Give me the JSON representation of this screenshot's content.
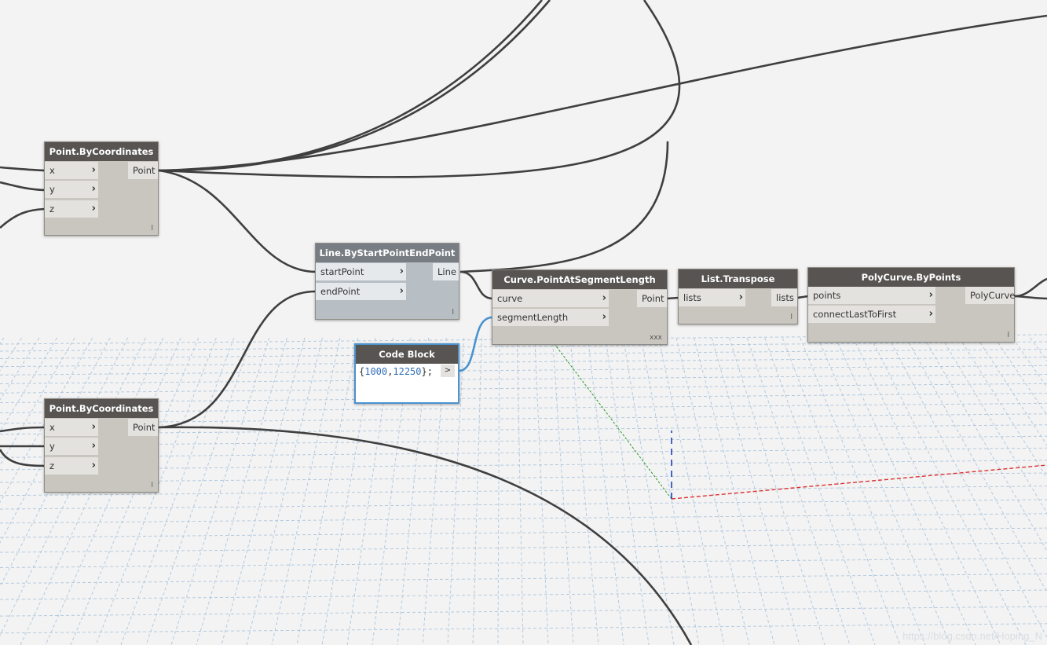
{
  "nodes": {
    "point1": {
      "title": "Point.ByCoordinates",
      "inputs": [
        "x",
        "y",
        "z"
      ],
      "output": "Point",
      "lacing": "l"
    },
    "point2": {
      "title": "Point.ByCoordinates",
      "inputs": [
        "x",
        "y",
        "z"
      ],
      "output": "Point",
      "lacing": "l"
    },
    "line": {
      "title": "Line.ByStartPointEndPoint",
      "inputs": [
        "startPoint",
        "endPoint"
      ],
      "output": "Line",
      "lacing": "l"
    },
    "curve_pt": {
      "title": "Curve.PointAtSegmentLength",
      "inputs": [
        "curve",
        "segmentLength"
      ],
      "output": "Point",
      "lacing": "xxx"
    },
    "transpose": {
      "title": "List.Transpose",
      "inputs": [
        "lists"
      ],
      "output": "lists",
      "lacing": "l"
    },
    "polycurve": {
      "title": "PolyCurve.ByPoints",
      "inputs": [
        "points",
        "connectLastToFirst"
      ],
      "output": "PolyCurve",
      "lacing": "l"
    },
    "codeblock": {
      "title": "Code Block",
      "code_open": "{",
      "num1": "1000",
      "comma": ",",
      "num2": "12250",
      "code_close": "};",
      "output_label": ">"
    }
  },
  "watermark": "https://blog.csdn.net/Hoping_N",
  "colors": {
    "background": "#f3f3f3",
    "grid": "#a9c4dc",
    "node_header": "#575452",
    "node_body": "#c9c6c0",
    "selected_wire": "#4a92d0",
    "axis_x": "#e03030",
    "axis_y": "#2a9a2a",
    "axis_z": "#2040c0"
  }
}
